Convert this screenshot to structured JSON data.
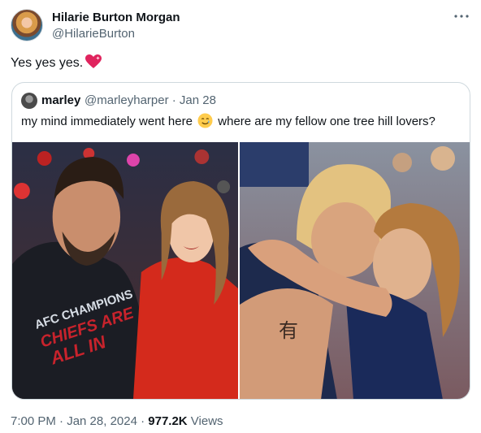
{
  "author": {
    "name": "Hilarie Burton Morgan",
    "handle": "@HilarieBurton"
  },
  "tweet": {
    "text": "Yes yes yes.",
    "emoji": "red-heart-sparkle"
  },
  "quote": {
    "name": "marley",
    "handle_and_date": "@marleyharper · Jan 28",
    "text_before_emoji": "my mind immediately went here",
    "emoji": "smiling-face-with-tear",
    "text_after_emoji": "where are my fellow one tree hill lovers?"
  },
  "meta": {
    "time_date": "7:00 PM · Jan 28, 2024 · ",
    "views_count": "977.2K",
    "views_label": " Views"
  },
  "media_text": {
    "shirt_line1": "AFC CHAMPIONS",
    "shirt_line2": "CHIEFS ARE",
    "shirt_line3": "ALL IN",
    "arm_tattoo": "有"
  }
}
